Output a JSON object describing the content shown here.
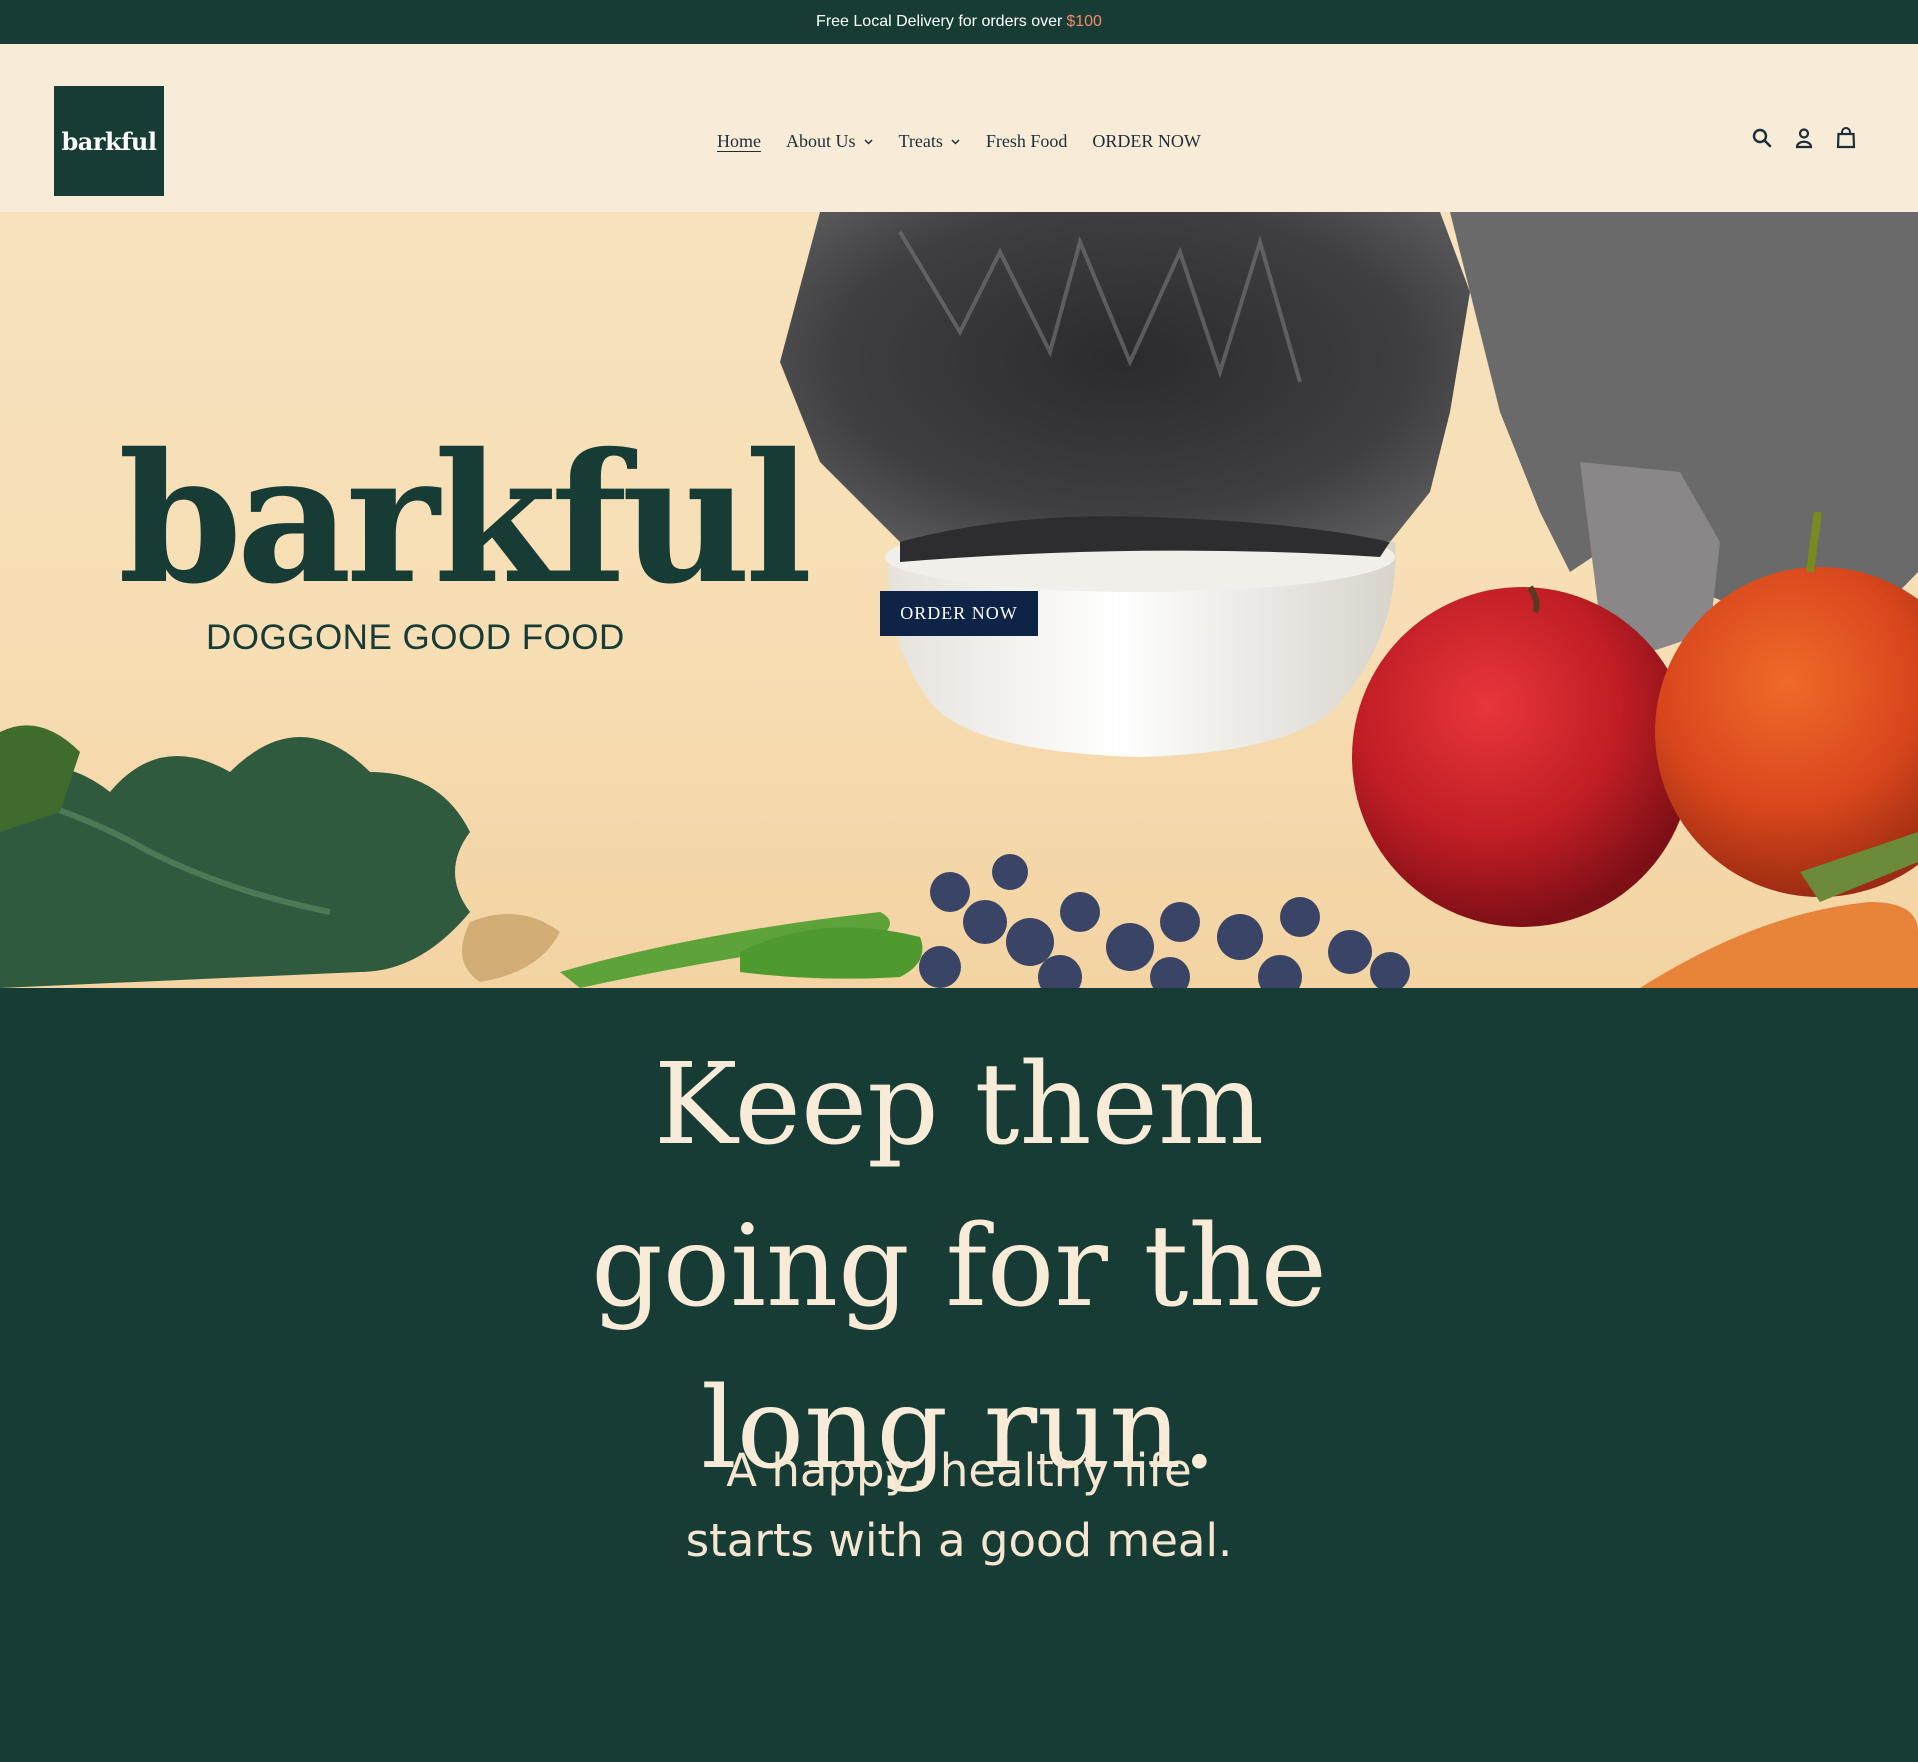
{
  "announcement": {
    "text": "Free Local Delivery for orders over",
    "amount": "$100"
  },
  "header": {
    "logo_text": "barkful",
    "nav": [
      {
        "label": "Home",
        "active": true,
        "dropdown": false
      },
      {
        "label": "About Us",
        "active": false,
        "dropdown": true
      },
      {
        "label": "Treats",
        "active": false,
        "dropdown": true
      },
      {
        "label": "Fresh Food",
        "active": false,
        "dropdown": false
      },
      {
        "label": "ORDER NOW",
        "active": false,
        "dropdown": false
      }
    ],
    "icons": [
      "search-icon",
      "account-icon",
      "cart-icon"
    ]
  },
  "hero": {
    "brand": "barkful",
    "tagline": "DOGGONE GOOD FOOD",
    "button_label": "ORDER NOW"
  },
  "section": {
    "headline_lines": [
      "Keep them",
      "going for the",
      "long run."
    ],
    "sub_lines": [
      "A happy, healthy life",
      "starts with a good meal."
    ]
  },
  "colors": {
    "brand_green": "#173c36",
    "cream": "#f8ecd8",
    "navy_button": "#0e2447",
    "accent_price": "#f08a68"
  }
}
